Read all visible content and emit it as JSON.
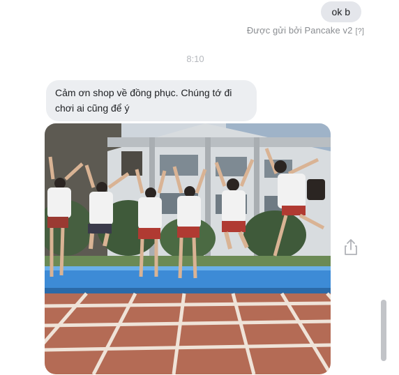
{
  "conversation": {
    "sent_message": "ok b",
    "sent_by": "Được gửi bởi Pancake v2",
    "help_marker": "[?]",
    "timestamp": "8:10",
    "received_message": "Cảm ơn shop về đồng phục. Chúng tớ đi chơi ai cũng để ý"
  },
  "icons": {
    "share": "share-icon"
  },
  "colors": {
    "sent_bubble": "#e4e6eb",
    "received_bubble": "#eceef1",
    "meta_text": "#8a8d91",
    "scrollbar_thumb": "#c2c4c8"
  }
}
